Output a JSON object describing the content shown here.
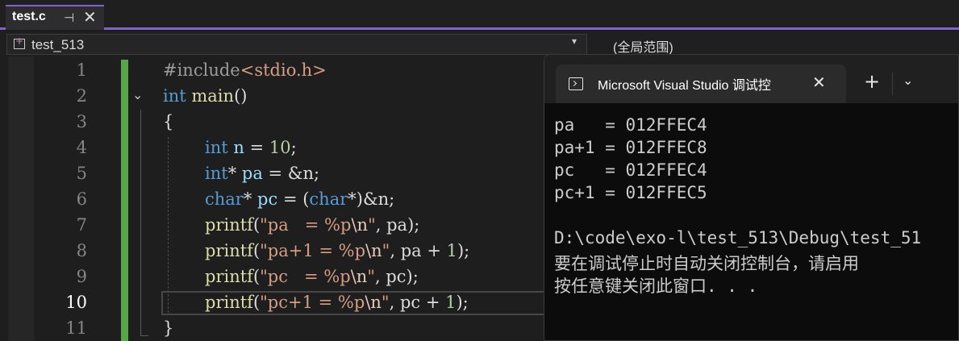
{
  "tab": {
    "title": "test.c",
    "pin_icon": "pin-icon",
    "close_icon": "close-icon",
    "close_glyph": "✕",
    "pin_glyph": "⊣"
  },
  "nav": {
    "project": "test_513",
    "scope": "(全局范围)",
    "dropdown_glyph": "▾"
  },
  "editor": {
    "line_numbers": [
      "1",
      "2",
      "3",
      "4",
      "5",
      "6",
      "7",
      "8",
      "9",
      "10",
      "11"
    ],
    "active_line": "10",
    "fold_glyph": "⌄",
    "code": {
      "l1": {
        "pp": "#include",
        "header": "<stdio.h>"
      },
      "l2": {
        "kw": "int",
        "fn": "main",
        "rest": "()"
      },
      "l3": {
        "text": "{"
      },
      "l4": {
        "kw": "int",
        "var": " n",
        "op": " = ",
        "num": "10",
        "end": ";"
      },
      "l5": {
        "kw": "int",
        "op": "* ",
        "var": "pa",
        "rest": " = &n;"
      },
      "l6": {
        "kw": "char",
        "op": "* ",
        "var": "pc",
        "rest1": " = (",
        "kw2": "char",
        "rest2": "*)&n;"
      },
      "l7": {
        "fn": "printf",
        "open": "(",
        "str_a": "\"pa   = %p",
        "esc": "\\n",
        "str_b": "\"",
        "rest": ", pa);"
      },
      "l8": {
        "fn": "printf",
        "open": "(",
        "str_a": "\"pa+1 = %p",
        "esc": "\\n",
        "str_b": "\"",
        "rest1": ", pa + ",
        "num": "1",
        "rest2": ");"
      },
      "l9": {
        "fn": "printf",
        "open": "(",
        "str_a": "\"pc   = %p",
        "esc": "\\n",
        "str_b": "\"",
        "rest": ", pc);"
      },
      "l10": {
        "fn": "printf",
        "open": "(",
        "str_a": "\"pc+1 = %p",
        "esc": "\\n",
        "str_b": "\"",
        "rest1": ", pc + ",
        "num": "1",
        "rest2": ");"
      },
      "l11": {
        "text": "}"
      }
    }
  },
  "console": {
    "title": "Microsoft Visual Studio 调试控",
    "close_glyph": "✕",
    "new_tab_glyph": "+",
    "dropdown_glyph": "⌄",
    "output": [
      "pa   = 012FFEC4",
      "pa+1 = 012FFEC8",
      "pc   = 012FFEC4",
      "pc+1 = 012FFEC5",
      "",
      "D:\\code\\exo-l\\test_513\\Debug\\test_51",
      "要在调试停止时自动关闭控制台，请启用",
      "按任意键关闭此窗口. . ."
    ]
  },
  "colors": {
    "accent": "#7f63c8",
    "change_bar": "#57a64a",
    "keyword": "#569cd6",
    "function": "#dcdcaa",
    "string": "#d69d85",
    "number": "#b5cea8",
    "variable": "#9cdcfe"
  }
}
